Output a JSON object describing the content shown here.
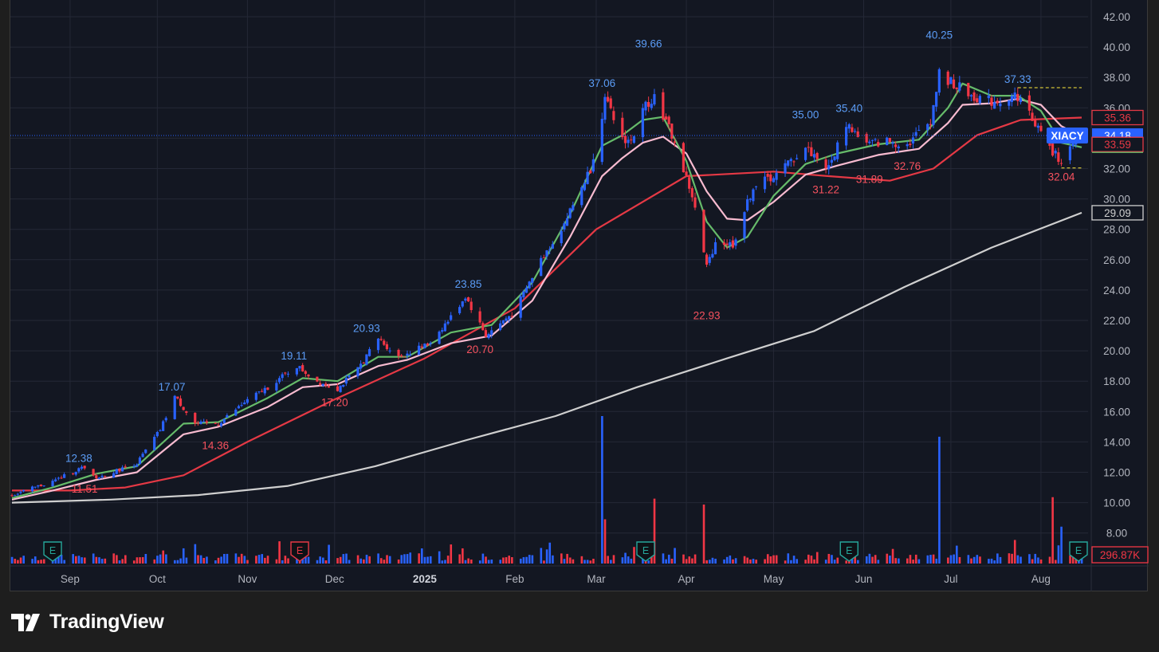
{
  "app": {
    "brand_name": "TradingView",
    "brand_icon": "tradingview-logo-icon"
  },
  "chart_data": {
    "type": "candlestick",
    "symbol": "XIACY",
    "last_price_label": "34.18",
    "y_axis": {
      "min": 7.0,
      "max": 42.0,
      "ticks": [
        "42.00",
        "40.00",
        "38.00",
        "36.00",
        "34.00",
        "32.00",
        "30.00",
        "28.00",
        "26.00",
        "24.00",
        "22.00",
        "20.00",
        "18.00",
        "16.00",
        "14.00",
        "12.00",
        "10.00",
        "8.00"
      ]
    },
    "x_axis": {
      "ticks": [
        {
          "label": "Sep",
          "date": "2024-09-01",
          "bold": false
        },
        {
          "label": "Oct",
          "date": "2024-10-01",
          "bold": false
        },
        {
          "label": "Nov",
          "date": "2024-11-01",
          "bold": false
        },
        {
          "label": "Dec",
          "date": "2024-12-01",
          "bold": false
        },
        {
          "label": "2025",
          "date": "2025-01-01",
          "bold": true
        },
        {
          "label": "Feb",
          "date": "2025-02-01",
          "bold": false
        },
        {
          "label": "Mar",
          "date": "2025-03-01",
          "bold": false
        },
        {
          "label": "Apr",
          "date": "2025-04-01",
          "bold": false
        },
        {
          "label": "May",
          "date": "2025-05-01",
          "bold": false
        },
        {
          "label": "Jun",
          "date": "2025-06-01",
          "bold": false
        },
        {
          "label": "Jul",
          "date": "2025-07-01",
          "bold": false
        },
        {
          "label": "Aug",
          "date": "2025-08-01",
          "bold": false
        }
      ]
    },
    "price_path": [
      [
        "2024-08-12",
        10.5
      ],
      [
        "2024-08-26",
        11.4
      ],
      [
        "2024-09-05",
        12.3
      ],
      [
        "2024-09-10",
        11.6
      ],
      [
        "2024-09-24",
        12.6
      ],
      [
        "2024-10-02",
        14.8
      ],
      [
        "2024-10-07",
        17.0
      ],
      [
        "2024-10-14",
        15.2
      ],
      [
        "2024-10-22",
        15.2
      ],
      [
        "2024-10-31",
        16.6
      ],
      [
        "2024-11-08",
        17.6
      ],
      [
        "2024-11-18",
        19.0
      ],
      [
        "2024-11-25",
        18.0
      ],
      [
        "2024-12-02",
        17.5
      ],
      [
        "2024-12-09",
        18.8
      ],
      [
        "2024-12-16",
        20.8
      ],
      [
        "2024-12-23",
        19.6
      ],
      [
        "2025-01-02",
        20.4
      ],
      [
        "2025-01-10",
        22.2
      ],
      [
        "2025-01-15",
        23.6
      ],
      [
        "2025-01-22",
        21.0
      ],
      [
        "2025-02-01",
        22.6
      ],
      [
        "2025-02-10",
        26.0
      ],
      [
        "2025-02-18",
        28.4
      ],
      [
        "2025-02-27",
        32.0
      ],
      [
        "2025-03-04",
        36.5
      ],
      [
        "2025-03-10",
        34.0
      ],
      [
        "2025-03-13",
        33.8
      ],
      [
        "2025-03-18",
        36.2
      ],
      [
        "2025-03-21",
        36.8
      ],
      [
        "2025-03-27",
        34.2
      ],
      [
        "2025-04-03",
        30.2
      ],
      [
        "2025-04-08",
        25.5
      ],
      [
        "2025-04-11",
        27.2
      ],
      [
        "2025-04-17",
        27.0
      ],
      [
        "2025-04-24",
        30.8
      ],
      [
        "2025-05-02",
        31.6
      ],
      [
        "2025-05-12",
        33.4
      ],
      [
        "2025-05-20",
        32.0
      ],
      [
        "2025-05-26",
        35.0
      ],
      [
        "2025-06-02",
        33.6
      ],
      [
        "2025-06-09",
        33.8
      ],
      [
        "2025-06-16",
        33.6
      ],
      [
        "2025-06-24",
        35.2
      ],
      [
        "2025-06-27",
        38.2
      ],
      [
        "2025-07-08",
        36.8
      ],
      [
        "2025-07-15",
        36.4
      ],
      [
        "2025-07-24",
        36.8
      ],
      [
        "2025-07-30",
        35.0
      ],
      [
        "2025-08-05",
        33.0
      ],
      [
        "2025-08-08",
        32.6
      ],
      [
        "2025-08-15",
        34.18
      ]
    ],
    "moving_averages": [
      {
        "name": "MA (short, green)",
        "color": "#66bb6a",
        "points": [
          [
            "2024-08-12",
            10.3
          ],
          [
            "2024-08-26",
            11.0
          ],
          [
            "2024-09-10",
            11.9
          ],
          [
            "2024-09-24",
            12.4
          ],
          [
            "2024-10-10",
            15.2
          ],
          [
            "2024-10-22",
            15.3
          ],
          [
            "2024-11-08",
            16.9
          ],
          [
            "2024-11-20",
            18.2
          ],
          [
            "2024-12-02",
            18.0
          ],
          [
            "2024-12-16",
            19.6
          ],
          [
            "2024-12-26",
            19.6
          ],
          [
            "2025-01-10",
            21.2
          ],
          [
            "2025-01-24",
            21.7
          ],
          [
            "2025-02-07",
            24.5
          ],
          [
            "2025-02-20",
            29.0
          ],
          [
            "2025-03-03",
            33.5
          ],
          [
            "2025-03-10",
            34.2
          ],
          [
            "2025-03-17",
            35.2
          ],
          [
            "2025-03-24",
            35.4
          ],
          [
            "2025-04-01",
            32.5
          ],
          [
            "2025-04-08",
            28.5
          ],
          [
            "2025-04-15",
            26.8
          ],
          [
            "2025-04-22",
            27.5
          ],
          [
            "2025-05-01",
            30.2
          ],
          [
            "2025-05-12",
            32.3
          ],
          [
            "2025-05-23",
            33.0
          ],
          [
            "2025-06-06",
            33.6
          ],
          [
            "2025-06-20",
            33.9
          ],
          [
            "2025-06-30",
            36.0
          ],
          [
            "2025-07-05",
            37.6
          ],
          [
            "2025-07-15",
            36.8
          ],
          [
            "2025-07-24",
            36.8
          ],
          [
            "2025-08-01",
            35.8
          ],
          [
            "2025-08-08",
            33.7
          ],
          [
            "2025-08-15",
            33.4
          ]
        ]
      },
      {
        "name": "MA (medium, pink)",
        "color": "#f8bbd0",
        "points": [
          [
            "2024-08-12",
            10.2
          ],
          [
            "2024-08-26",
            10.8
          ],
          [
            "2024-09-10",
            11.5
          ],
          [
            "2024-09-24",
            12.0
          ],
          [
            "2024-10-10",
            14.5
          ],
          [
            "2024-10-22",
            15.0
          ],
          [
            "2024-11-08",
            16.3
          ],
          [
            "2024-11-20",
            17.6
          ],
          [
            "2024-12-02",
            17.8
          ],
          [
            "2024-12-16",
            19.0
          ],
          [
            "2024-12-26",
            19.4
          ],
          [
            "2025-01-10",
            20.5
          ],
          [
            "2025-01-24",
            21.0
          ],
          [
            "2025-02-07",
            23.3
          ],
          [
            "2025-02-20",
            27.5
          ],
          [
            "2025-03-03",
            31.5
          ],
          [
            "2025-03-10",
            32.7
          ],
          [
            "2025-03-17",
            33.7
          ],
          [
            "2025-03-24",
            34.1
          ],
          [
            "2025-04-01",
            33.0
          ],
          [
            "2025-04-08",
            30.5
          ],
          [
            "2025-04-15",
            28.7
          ],
          [
            "2025-04-22",
            28.6
          ],
          [
            "2025-05-01",
            29.8
          ],
          [
            "2025-05-12",
            31.6
          ],
          [
            "2025-05-23",
            32.2
          ],
          [
            "2025-06-06",
            32.9
          ],
          [
            "2025-06-20",
            33.3
          ],
          [
            "2025-06-30",
            35.0
          ],
          [
            "2025-07-05",
            36.2
          ],
          [
            "2025-07-15",
            36.3
          ],
          [
            "2025-07-24",
            36.6
          ],
          [
            "2025-08-01",
            36.2
          ],
          [
            "2025-08-08",
            34.8
          ],
          [
            "2025-08-15",
            34.1
          ]
        ]
      },
      {
        "name": "MA (long, red)",
        "color": "#e53945",
        "points": [
          [
            "2024-08-12",
            10.8
          ],
          [
            "2024-09-01",
            10.8
          ],
          [
            "2024-09-20",
            11.0
          ],
          [
            "2024-10-10",
            11.8
          ],
          [
            "2024-11-01",
            14.0
          ],
          [
            "2024-12-01",
            16.8
          ],
          [
            "2025-01-01",
            19.5
          ],
          [
            "2025-02-01",
            22.8
          ],
          [
            "2025-03-01",
            28.0
          ],
          [
            "2025-04-01",
            31.5
          ],
          [
            "2025-05-01",
            31.8
          ],
          [
            "2025-05-20",
            31.5
          ],
          [
            "2025-06-10",
            31.2
          ],
          [
            "2025-06-25",
            32.0
          ],
          [
            "2025-07-10",
            34.2
          ],
          [
            "2025-07-25",
            35.2
          ],
          [
            "2025-08-15",
            35.36
          ]
        ]
      },
      {
        "name": "MA (longest, white)",
        "color": "#cfcfcf",
        "points": [
          [
            "2024-08-12",
            10.0
          ],
          [
            "2024-09-15",
            10.2
          ],
          [
            "2024-10-15",
            10.5
          ],
          [
            "2024-11-15",
            11.1
          ],
          [
            "2024-12-15",
            12.4
          ],
          [
            "2025-01-15",
            14.1
          ],
          [
            "2025-02-15",
            15.7
          ],
          [
            "2025-03-15",
            17.6
          ],
          [
            "2025-04-15",
            19.5
          ],
          [
            "2025-05-15",
            21.3
          ],
          [
            "2025-06-15",
            24.2
          ],
          [
            "2025-07-15",
            26.8
          ],
          [
            "2025-08-15",
            29.09
          ]
        ]
      }
    ],
    "price_scale_labels": [
      {
        "value": 35.36,
        "text": "35.36",
        "color": "#e53945",
        "style": "outline"
      },
      {
        "value": 34.18,
        "text": "34.18",
        "color": "#2962ff",
        "style": "filled"
      },
      {
        "value": 33.59,
        "text": "33.59",
        "color": "#e53945",
        "style": "outline-green"
      },
      {
        "value": 29.09,
        "text": "29.09",
        "color": "#cfcfcf",
        "style": "outline"
      }
    ],
    "highs": [
      {
        "date": "2024-09-04",
        "value": 12.38,
        "text": "12.38"
      },
      {
        "date": "2024-10-06",
        "value": 17.07,
        "text": "17.07"
      },
      {
        "date": "2024-11-17",
        "value": 19.11,
        "text": "19.11"
      },
      {
        "date": "2024-12-12",
        "value": 20.93,
        "text": "20.93"
      },
      {
        "date": "2025-01-16",
        "value": 23.85,
        "text": "23.85"
      },
      {
        "date": "2025-03-03",
        "value": 37.06,
        "text": "37.06"
      },
      {
        "date": "2025-03-19",
        "value": 39.66,
        "text": "39.66"
      },
      {
        "date": "2025-05-12",
        "value": 35.0,
        "text": "35.00"
      },
      {
        "date": "2025-05-27",
        "value": 35.4,
        "text": "35.40"
      },
      {
        "date": "2025-06-27",
        "value": 40.25,
        "text": "40.25"
      },
      {
        "date": "2025-07-24",
        "value": 37.33,
        "text": "37.33"
      }
    ],
    "lows": [
      {
        "date": "2024-09-06",
        "value": 11.51,
        "text": "11.51"
      },
      {
        "date": "2024-10-21",
        "value": 14.36,
        "text": "14.36"
      },
      {
        "date": "2024-12-01",
        "value": 17.2,
        "text": "17.20"
      },
      {
        "date": "2025-01-20",
        "value": 20.7,
        "text": "20.70"
      },
      {
        "date": "2025-04-08",
        "value": 22.93,
        "text": "22.93"
      },
      {
        "date": "2025-05-19",
        "value": 31.22,
        "text": "31.22"
      },
      {
        "date": "2025-06-03",
        "value": 31.89,
        "text": "31.89"
      },
      {
        "date": "2025-06-16",
        "value": 32.76,
        "text": "32.76"
      },
      {
        "date": "2025-08-08",
        "value": 32.04,
        "text": "32.04"
      }
    ],
    "dashed_levels": [
      {
        "value": 37.33,
        "from": "2025-07-24",
        "to": "2025-08-15",
        "color": "#ffeb3b"
      },
      {
        "value": 32.04,
        "from": "2025-08-08",
        "to": "2025-08-15",
        "color": "#ffeb3b"
      }
    ],
    "events": [
      {
        "date": "2024-08-26",
        "type": "earnings",
        "text": "E",
        "color": "#26a69a"
      },
      {
        "date": "2024-11-19",
        "type": "earnings",
        "text": "E",
        "color": "#e53945"
      },
      {
        "date": "2025-03-18",
        "type": "earnings",
        "text": "E",
        "color": "#26a69a"
      },
      {
        "date": "2025-05-27",
        "type": "earnings",
        "text": "E",
        "color": "#26a69a"
      },
      {
        "date": "2025-08-19",
        "type": "earnings",
        "text": "E",
        "color": "#26a69a"
      }
    ],
    "volume": {
      "last_label": "296.87K",
      "spikes": [
        {
          "date": "2025-03-03",
          "value": 1.0
        },
        {
          "date": "2025-03-04",
          "value": 0.3
        },
        {
          "date": "2025-03-21",
          "value": 0.44
        },
        {
          "date": "2025-04-07",
          "value": 0.4
        },
        {
          "date": "2025-06-27",
          "value": 0.86
        },
        {
          "date": "2025-08-05",
          "value": 0.45
        },
        {
          "date": "2025-08-08",
          "value": 0.25
        }
      ]
    },
    "colors": {
      "up": "#2962ff",
      "down": "#f23645",
      "high_text": "#5b9cf6",
      "low_text": "#f7525f",
      "grid": "#242836",
      "axis_text": "#b2b5be",
      "background": "#131722"
    },
    "legend": "none",
    "grid": true
  }
}
